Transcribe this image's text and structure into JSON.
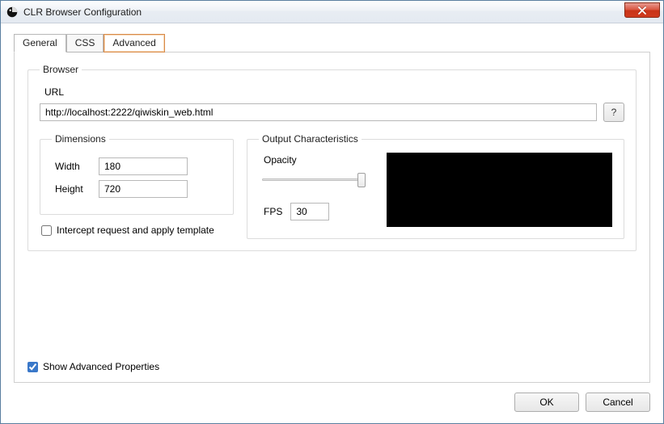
{
  "window": {
    "title": "CLR Browser Configuration"
  },
  "tabs": {
    "general": "General",
    "css": "CSS",
    "advanced": "Advanced"
  },
  "browser_group": {
    "legend": "Browser",
    "url_label": "URL",
    "url_value": "http://localhost:2222/qiwiskin_web.html",
    "help_label": "?"
  },
  "dimensions": {
    "legend": "Dimensions",
    "width_label": "Width",
    "width_value": "180",
    "height_label": "Height",
    "height_value": "720"
  },
  "intercept": {
    "label": "Intercept request and apply template",
    "checked": false
  },
  "output": {
    "legend": "Output Characteristics",
    "opacity_label": "Opacity",
    "fps_label": "FPS",
    "fps_value": "30"
  },
  "show_adv": {
    "label": "Show Advanced Properties",
    "checked": true
  },
  "footer": {
    "ok": "OK",
    "cancel": "Cancel"
  }
}
